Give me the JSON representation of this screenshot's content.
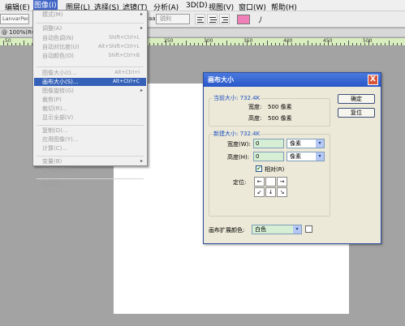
{
  "menubar": {
    "items": [
      "编辑(E)",
      "图像(I)",
      "图层(L)",
      "选择(S)",
      "滤镜(T)",
      "分析(A)",
      "3D(D)",
      "视图(V)",
      "窗口(W)",
      "帮助(H)"
    ]
  },
  "options": {
    "font_family": "LanvarPen",
    "aa_label": "aa",
    "aa_value": "锐利",
    "swatch_color": "#f080b8",
    "warp_symbol": "ﾉ"
  },
  "document_tab": "@ 100%(RG",
  "ruler": {
    "ticks": [
      "50",
      "100",
      "150",
      "200",
      "250",
      "300",
      "350",
      "400",
      "450",
      "500"
    ]
  },
  "image_menu": {
    "items": [
      {
        "label": "模式(M)",
        "shortcut": "",
        "submenu": true,
        "highlighted": false
      },
      {
        "label": "调整(A)",
        "shortcut": "",
        "submenu": true,
        "highlighted": false
      },
      {
        "label": "自动色调(N)",
        "shortcut": "Shift+Ctrl+L",
        "submenu": false,
        "highlighted": false
      },
      {
        "label": "自动对比度(U)",
        "shortcut": "Alt+Shift+Ctrl+L",
        "submenu": false,
        "highlighted": false
      },
      {
        "label": "自动颜色(O)",
        "shortcut": "Shift+Ctrl+B",
        "submenu": false,
        "highlighted": false
      },
      {
        "label": "图像大小(I)...",
        "shortcut": "Alt+Ctrl+I",
        "submenu": false,
        "highlighted": false
      },
      {
        "label": "画布大小(S)...",
        "shortcut": "Alt+Ctrl+C",
        "submenu": false,
        "highlighted": true
      },
      {
        "label": "图像旋转(G)",
        "shortcut": "",
        "submenu": true,
        "highlighted": false
      },
      {
        "label": "裁剪(P)",
        "shortcut": "",
        "submenu": false,
        "highlighted": false
      },
      {
        "label": "裁切(R)...",
        "shortcut": "",
        "submenu": false,
        "highlighted": false
      },
      {
        "label": "显示全部(V)",
        "shortcut": "",
        "submenu": false,
        "highlighted": false
      },
      {
        "label": "复制(D)...",
        "shortcut": "",
        "submenu": false,
        "highlighted": false
      },
      {
        "label": "应用图像(Y)...",
        "shortcut": "",
        "submenu": false,
        "highlighted": false
      },
      {
        "label": "计算(C)...",
        "shortcut": "",
        "submenu": false,
        "highlighted": false
      },
      {
        "label": "变量(B)",
        "shortcut": "",
        "submenu": true,
        "highlighted": false
      },
      {
        "label": "应用数据组(L)...",
        "shortcut": "",
        "submenu": false,
        "highlighted": false
      },
      {
        "label": "陷印(T)...",
        "shortcut": "",
        "submenu": false,
        "highlighted": false
      }
    ]
  },
  "dialog": {
    "title": "画布大小",
    "close_symbol": "X",
    "ok_label": "确定",
    "reset_label": "复位",
    "current_size_legend": "当前大小: 732.4K",
    "current_width_label": "宽度:",
    "current_width_value": "500 像素",
    "current_height_label": "高度:",
    "current_height_value": "500 像素",
    "new_size_legend": "新建大小: 732.4K",
    "width_label": "宽度(W):",
    "width_value": "0",
    "width_unit": "像素",
    "height_label": "高度(H):",
    "height_value": "0",
    "height_unit": "像素",
    "relative_check": "✔",
    "relative_label": "相对(R)",
    "anchor_label": "定位:",
    "anchor_arrows": [
      "←",
      "",
      "→",
      "↙",
      "↓",
      "↘"
    ],
    "dropdown_arrow": "▾",
    "extension_label": "画布扩展颜色:",
    "extension_value": "白色"
  }
}
